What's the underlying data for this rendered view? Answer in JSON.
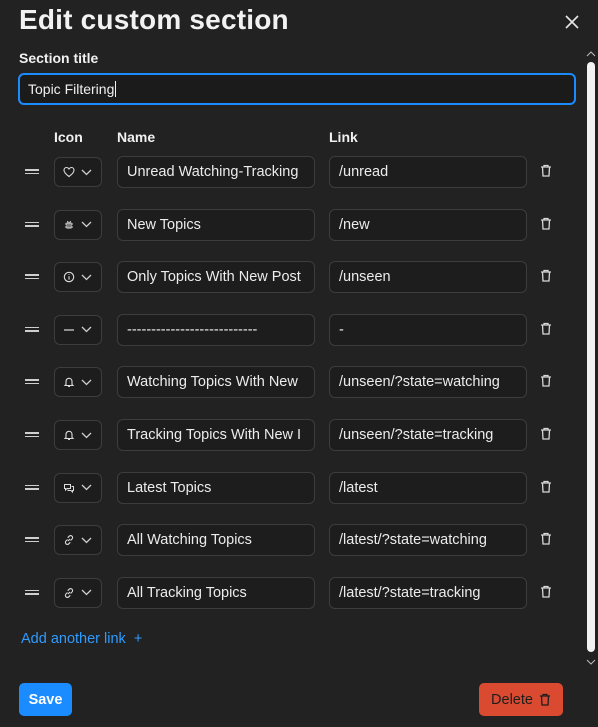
{
  "modal": {
    "title": "Edit custom section",
    "section_title_label": "Section title",
    "section_title_value": "Topic Filtering"
  },
  "columns": {
    "icon": "Icon",
    "name": "Name",
    "link": "Link"
  },
  "links": [
    {
      "icon": "heart-icon",
      "name": "Unread Watching-Tracking",
      "link": "/unread"
    },
    {
      "icon": "bug-icon",
      "name": "New Topics",
      "link": "/new"
    },
    {
      "icon": "info-icon",
      "name": "Only Topics With New Post",
      "link": "/unseen"
    },
    {
      "icon": "minus-icon",
      "name": "---------------------------",
      "link": "-"
    },
    {
      "icon": "bell-icon",
      "name": "Watching Topics With New",
      "link": "/unseen/?state=watching"
    },
    {
      "icon": "bell-icon",
      "name": "Tracking Topics With New I",
      "link": "/unseen/?state=tracking"
    },
    {
      "icon": "comments-icon",
      "name": "Latest Topics",
      "link": "/latest"
    },
    {
      "icon": "link-icon",
      "name": "All Watching Topics",
      "link": "/latest/?state=watching"
    },
    {
      "icon": "link-icon",
      "name": "All Tracking Topics",
      "link": "/latest/?state=tracking"
    }
  ],
  "add_link_label": "Add another link",
  "add_link_plus": "+",
  "footer": {
    "save_label": "Save",
    "delete_label": "Delete"
  },
  "colors": {
    "accent": "#1a8cff",
    "danger": "#d94a30",
    "background": "#222222"
  }
}
